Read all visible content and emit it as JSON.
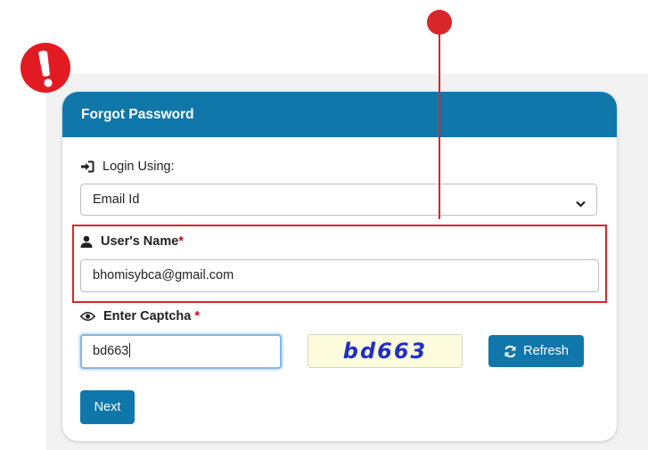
{
  "form": {
    "title": "Forgot Password",
    "login_using_label": "Login Using:",
    "login_using_value": "Email Id",
    "username_label": "User's Name",
    "username_required": "*",
    "username_value": "bhomisybca@gmail.com",
    "captcha_label": "Enter Captcha",
    "captcha_required": "*",
    "captcha_input_value": "bd663",
    "captcha_image_text": "bd663",
    "refresh_label": "Refresh",
    "next_label": "Next"
  },
  "icons": {
    "alert": "exclamation-alert-icon",
    "login": "sign-in-icon",
    "user": "user-icon",
    "eye": "eye-icon",
    "refresh": "refresh-icon",
    "select": "chevron-down-icon"
  },
  "colors": {
    "header": "#1077ab",
    "button": "#1077ab",
    "annotation": "#d8262b",
    "required": "#d0021b",
    "captcha_text": "#1f2fc5",
    "captcha_bg": "#fcfbdc"
  }
}
